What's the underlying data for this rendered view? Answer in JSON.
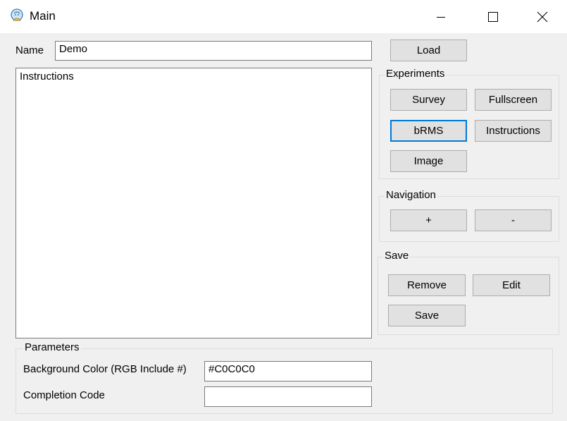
{
  "window": {
    "title": "Main",
    "app_icon": "assistant-icon",
    "controls": [
      "minimize-icon",
      "maximize-icon",
      "close-icon"
    ]
  },
  "name_field": {
    "label": "Name",
    "value": "Demo"
  },
  "instructions": {
    "value": "Instructions"
  },
  "load_button": "Load",
  "experiments": {
    "title": "Experiments",
    "buttons": {
      "survey": "Survey",
      "fullscreen": "Fullscreen",
      "brms": "bRMS",
      "instructions": "Instructions",
      "image": "Image"
    }
  },
  "navigation": {
    "title": "Navigation",
    "buttons": {
      "plus": "+",
      "minus": "-"
    }
  },
  "save_group": {
    "title": "Save",
    "buttons": {
      "remove": "Remove",
      "edit": "Edit",
      "save": "Save"
    }
  },
  "parameters": {
    "title": "Parameters",
    "bg_color_label": "Background Color (RGB Include #)",
    "bg_color_value": "#C0C0C0",
    "completion_code_label": "Completion Code",
    "completion_code_value": ""
  }
}
